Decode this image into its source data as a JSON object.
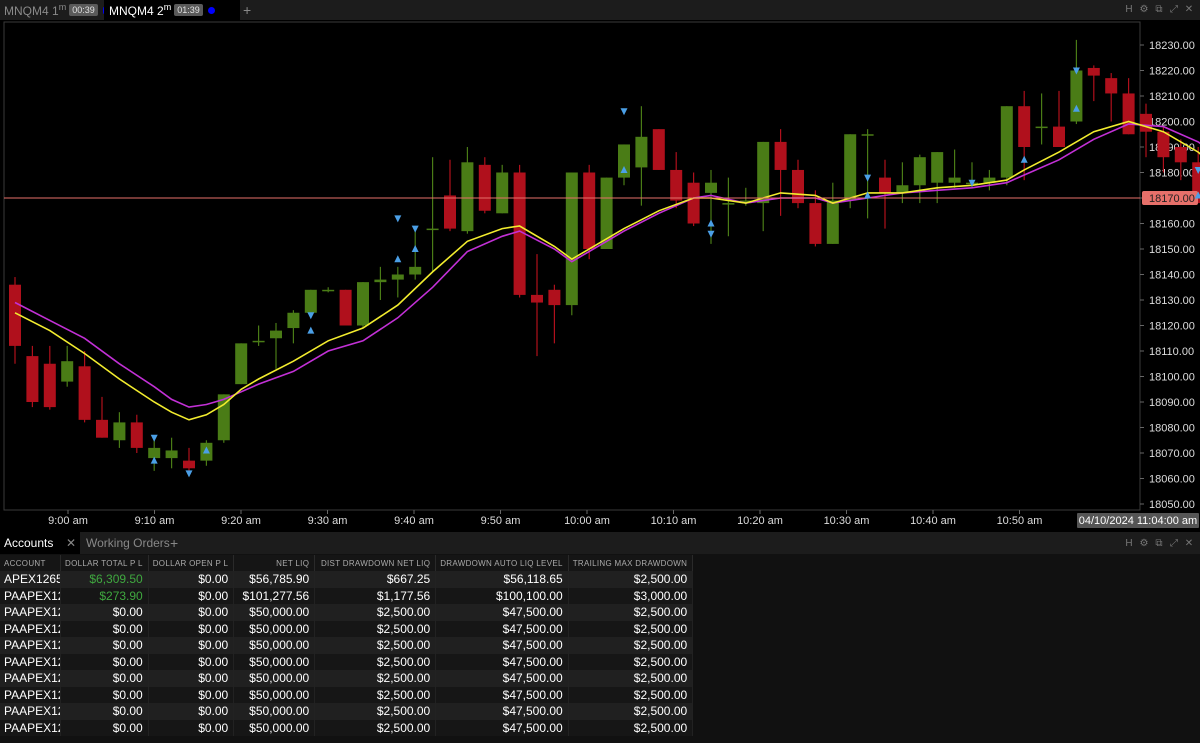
{
  "tabs": [
    {
      "name": "MNQM4 1",
      "sup": "m",
      "timer": "00:39"
    },
    {
      "name": "MNQM4 2",
      "sup": "m",
      "timer": "01:39"
    }
  ],
  "add_tab_label": "+",
  "window_controls": [
    "H",
    "⚙",
    "⧉",
    "⤢",
    "✕"
  ],
  "chart_data": {
    "type": "candlestick",
    "time_labels": [
      "9:00 am",
      "9:10 am",
      "9:20 am",
      "9:30 am",
      "9:40 am",
      "9:50 am",
      "10:00 am",
      "10:10 am",
      "10:20 am",
      "10:30 am",
      "10:40 am",
      "10:50 am"
    ],
    "cursor_time_label": "04/10/2024 11:04:00 am",
    "price_labels": [
      "18230.00",
      "18220.00",
      "18210.00",
      "18200.00",
      "18190.00",
      "18180.00",
      "18170.00",
      "18160.00",
      "18150.00",
      "18140.00",
      "18130.00",
      "18120.00",
      "18110.00",
      "18100.00",
      "18090.00",
      "18080.00",
      "18070.00",
      "18060.00",
      "18050.00"
    ],
    "horizontal_line_price": 18170,
    "horizontal_line_label": "18170.00",
    "ylim": [
      18046,
      18243
    ],
    "colors": {
      "up": "#4a7c16",
      "down": "#b0101c",
      "line": "#e6706a",
      "ema_fast": "#f2ec2e",
      "ema_slow": "#c230d6",
      "marker": "#4b9fe6"
    },
    "bar_minutes": 2,
    "first_bar_time": "8:52 am",
    "candles": [
      [
        18136,
        18139,
        18105,
        18112
      ],
      [
        18108,
        18112,
        18088,
        18090
      ],
      [
        18105,
        18112,
        18087,
        18088
      ],
      [
        18098,
        18112,
        18096,
        18106
      ],
      [
        18104,
        18110,
        18082,
        18083
      ],
      [
        18083,
        18092,
        18076,
        18076
      ],
      [
        18075,
        18086,
        18072,
        18082
      ],
      [
        18082,
        18085,
        18070,
        18072
      ],
      [
        18068,
        18076,
        18063,
        18072
      ],
      [
        18068,
        18076,
        18064,
        18071
      ],
      [
        18067,
        18072,
        18062,
        18064
      ],
      [
        18067,
        18075,
        18065,
        18074
      ],
      [
        18075,
        18093,
        18074,
        18093
      ],
      [
        18097,
        18113,
        18097,
        18113
      ],
      [
        18114,
        18120,
        18112,
        18114
      ],
      [
        18115,
        18121,
        18103,
        18118
      ],
      [
        18119,
        18126,
        18113,
        18125
      ],
      [
        18125,
        18134,
        18124,
        18134
      ],
      [
        18134,
        18135,
        18133,
        18134
      ],
      [
        18134,
        18130,
        18133,
        18120
      ],
      [
        18120,
        18137,
        18119,
        18137
      ],
      [
        18137,
        18143,
        18130,
        18138
      ],
      [
        18138,
        18143,
        18131,
        18140
      ],
      [
        18140,
        18158,
        18138,
        18143
      ],
      [
        18158,
        18186,
        18141,
        18158
      ],
      [
        18171,
        18185,
        18157,
        18158
      ],
      [
        18157,
        18190,
        18156,
        18184
      ],
      [
        18183,
        18186,
        18164,
        18165
      ],
      [
        18164,
        18183,
        18164,
        18180
      ],
      [
        18180,
        18183,
        18131,
        18132
      ],
      [
        18132,
        18148,
        18108,
        18129
      ],
      [
        18134,
        18136,
        18113,
        18128
      ],
      [
        18128,
        18154,
        18124,
        18180
      ],
      [
        18180,
        18183,
        18146,
        18150
      ],
      [
        18150,
        18170,
        18167,
        18178
      ],
      [
        18178,
        18181,
        18175,
        18191
      ],
      [
        18182,
        18206,
        18167,
        18194
      ],
      [
        18197,
        18196,
        18185,
        18181
      ],
      [
        18181,
        18188,
        18166,
        18169
      ],
      [
        18176,
        18180,
        18159,
        18160
      ],
      [
        18172,
        18181,
        18152,
        18176
      ],
      [
        18168,
        18178,
        18155,
        18168
      ],
      [
        18168,
        18174,
        18167,
        18169
      ],
      [
        18168,
        18180,
        18157,
        18192
      ],
      [
        18192,
        18197,
        18163,
        18181
      ],
      [
        18181,
        18185,
        18166,
        18168
      ],
      [
        18168,
        18173,
        18151,
        18152
      ],
      [
        18152,
        18176,
        18152,
        18169
      ],
      [
        18169,
        18191,
        18166,
        18195
      ],
      [
        18195,
        18197,
        18162,
        18195
      ],
      [
        18178,
        18185,
        18158,
        18172
      ],
      [
        18172,
        18184,
        18168,
        18175
      ],
      [
        18175,
        18187,
        18168,
        18186
      ],
      [
        18176,
        18188,
        18168,
        18188
      ],
      [
        18176,
        18189,
        18174,
        18178
      ],
      [
        18176,
        18184,
        18174,
        18176
      ],
      [
        18176,
        18181,
        18173,
        18178
      ],
      [
        18178,
        18205,
        18175,
        18206
      ],
      [
        18206,
        18212,
        18177,
        18190
      ],
      [
        18198,
        18211,
        18191,
        18198
      ],
      [
        18198,
        18212,
        18194,
        18190
      ],
      [
        18200,
        18232,
        18199,
        18220
      ],
      [
        18221,
        18222,
        18208,
        18218
      ],
      [
        18217,
        18219,
        18200,
        18211
      ],
      [
        18211,
        18217,
        18195,
        18195
      ],
      [
        18203,
        18207,
        18186,
        18196
      ],
      [
        18196,
        18198,
        18180,
        18186
      ],
      [
        18190,
        18193,
        18177,
        18184
      ],
      [
        18184,
        18190,
        18169,
        18168
      ],
      [
        18168,
        18171,
        18160,
        18161
      ],
      [
        18161,
        18162,
        18140,
        18145
      ],
      [
        18153,
        18163,
        18138,
        18153
      ],
      [
        18142,
        18166,
        18133,
        18154
      ],
      [
        18150,
        18158,
        18138,
        18155
      ],
      [
        18155,
        18159,
        18149,
        18151
      ],
      [
        18149,
        18160,
        18145,
        18153
      ],
      [
        18151,
        18154,
        18142,
        18149
      ]
    ],
    "markers": [
      {
        "bar": 8,
        "type": "up",
        "price": 18067
      },
      {
        "bar": 8,
        "type": "down",
        "price": 18076
      },
      {
        "bar": 10,
        "type": "down",
        "price": 18062
      },
      {
        "bar": 11,
        "type": "up",
        "price": 18071
      },
      {
        "bar": 17,
        "type": "up",
        "price": 18118
      },
      {
        "bar": 17,
        "type": "down",
        "price": 18124
      },
      {
        "bar": 22,
        "type": "up",
        "price": 18146
      },
      {
        "bar": 22,
        "type": "down",
        "price": 18162
      },
      {
        "bar": 23,
        "type": "up",
        "price": 18150
      },
      {
        "bar": 23,
        "type": "down",
        "price": 18158
      },
      {
        "bar": 35,
        "type": "up",
        "price": 18181
      },
      {
        "bar": 35,
        "type": "down",
        "price": 18204
      },
      {
        "bar": 40,
        "type": "up",
        "price": 18160
      },
      {
        "bar": 40,
        "type": "down",
        "price": 18156
      },
      {
        "bar": 49,
        "type": "up",
        "price": 18171
      },
      {
        "bar": 49,
        "type": "down",
        "price": 18178
      },
      {
        "bar": 55,
        "type": "down",
        "price": 18176
      },
      {
        "bar": 58,
        "type": "up",
        "price": 18185
      },
      {
        "bar": 61,
        "type": "up",
        "price": 18205
      },
      {
        "bar": 61,
        "type": "down",
        "price": 18220
      },
      {
        "bar": 68,
        "type": "up",
        "price": 18171
      },
      {
        "bar": 68,
        "type": "down",
        "price": 18181
      }
    ],
    "ema_fast": [
      [
        0,
        18125
      ],
      [
        2,
        18118
      ],
      [
        4,
        18109
      ],
      [
        6,
        18099
      ],
      [
        8,
        18090
      ],
      [
        9,
        18086
      ],
      [
        10,
        18083
      ],
      [
        11,
        18085
      ],
      [
        12,
        18089
      ],
      [
        13,
        18095
      ],
      [
        14,
        18099
      ],
      [
        16,
        18106
      ],
      [
        18,
        18114
      ],
      [
        20,
        18119
      ],
      [
        22,
        18128
      ],
      [
        24,
        18141
      ],
      [
        26,
        18153
      ],
      [
        28,
        18158
      ],
      [
        29,
        18159
      ],
      [
        31,
        18151
      ],
      [
        32,
        18146
      ],
      [
        34,
        18154
      ],
      [
        35,
        18158
      ],
      [
        37,
        18165
      ],
      [
        39,
        18170
      ],
      [
        40,
        18170
      ],
      [
        42,
        18168
      ],
      [
        44,
        18172
      ],
      [
        46,
        18171
      ],
      [
        47,
        18168
      ],
      [
        49,
        18172
      ],
      [
        51,
        18172
      ],
      [
        53,
        18174
      ],
      [
        55,
        18175
      ],
      [
        57,
        18177
      ],
      [
        58,
        18181
      ],
      [
        60,
        18188
      ],
      [
        62,
        18196
      ],
      [
        64,
        18200
      ],
      [
        66,
        18196
      ],
      [
        68,
        18188
      ],
      [
        70,
        18176
      ],
      [
        72,
        18165
      ],
      [
        74,
        18161
      ],
      [
        75,
        18158
      ],
      [
        76,
        18157
      ]
    ],
    "ema_slow": [
      [
        0,
        18129
      ],
      [
        2,
        18122
      ],
      [
        4,
        18115
      ],
      [
        6,
        18105
      ],
      [
        8,
        18096
      ],
      [
        9,
        18091
      ],
      [
        10,
        18088
      ],
      [
        11,
        18089
      ],
      [
        12,
        18091
      ],
      [
        13,
        18094
      ],
      [
        14,
        18097
      ],
      [
        16,
        18102
      ],
      [
        18,
        18110
      ],
      [
        20,
        18114
      ],
      [
        22,
        18123
      ],
      [
        24,
        18135
      ],
      [
        26,
        18149
      ],
      [
        28,
        18155
      ],
      [
        29,
        18157
      ],
      [
        31,
        18150
      ],
      [
        32,
        18145
      ],
      [
        34,
        18153
      ],
      [
        35,
        18157
      ],
      [
        37,
        18164
      ],
      [
        39,
        18170
      ],
      [
        40,
        18171
      ],
      [
        42,
        18168
      ],
      [
        44,
        18170
      ],
      [
        46,
        18170
      ],
      [
        47,
        18168
      ],
      [
        49,
        18170
      ],
      [
        51,
        18172
      ],
      [
        53,
        18173
      ],
      [
        55,
        18174
      ],
      [
        57,
        18176
      ],
      [
        58,
        18179
      ],
      [
        60,
        18185
      ],
      [
        62,
        18193
      ],
      [
        64,
        18199
      ],
      [
        66,
        18198
      ],
      [
        68,
        18192
      ],
      [
        70,
        18182
      ],
      [
        72,
        18170
      ],
      [
        74,
        18165
      ],
      [
        75,
        18162
      ],
      [
        76,
        18160
      ]
    ]
  },
  "bottom_panel": {
    "tabs": [
      "Accounts",
      "Working Orders"
    ],
    "close_label": "✕",
    "add_label": "+",
    "columns": [
      "ACCOUNT",
      "DOLLAR TOTAL P L",
      "DOLLAR OPEN P L",
      "NET LIQ",
      "DIST DRAWDOWN NET LIQ",
      "DRAWDOWN AUTO LIQ LEVEL",
      "TRAILING MAX DRAWDOWN"
    ],
    "rows": [
      [
        "APEX1265",
        "$6,309.50",
        "$0.00",
        "$56,785.90",
        "$667.25",
        "$56,118.65",
        "$2,500.00"
      ],
      [
        "PAAPEX12",
        "$273.90",
        "$0.00",
        "$101,277.56",
        "$1,177.56",
        "$100,100.00",
        "$3,000.00"
      ],
      [
        "PAAPEX12",
        "$0.00",
        "$0.00",
        "$50,000.00",
        "$2,500.00",
        "$47,500.00",
        "$2,500.00"
      ],
      [
        "PAAPEX12",
        "$0.00",
        "$0.00",
        "$50,000.00",
        "$2,500.00",
        "$47,500.00",
        "$2,500.00"
      ],
      [
        "PAAPEX12",
        "$0.00",
        "$0.00",
        "$50,000.00",
        "$2,500.00",
        "$47,500.00",
        "$2,500.00"
      ],
      [
        "PAAPEX12",
        "$0.00",
        "$0.00",
        "$50,000.00",
        "$2,500.00",
        "$47,500.00",
        "$2,500.00"
      ],
      [
        "PAAPEX12",
        "$0.00",
        "$0.00",
        "$50,000.00",
        "$2,500.00",
        "$47,500.00",
        "$2,500.00"
      ],
      [
        "PAAPEX12",
        "$0.00",
        "$0.00",
        "$50,000.00",
        "$2,500.00",
        "$47,500.00",
        "$2,500.00"
      ],
      [
        "PAAPEX12",
        "$0.00",
        "$0.00",
        "$50,000.00",
        "$2,500.00",
        "$47,500.00",
        "$2,500.00"
      ],
      [
        "PAAPEX12",
        "$0.00",
        "$0.00",
        "$50,000.00",
        "$2,500.00",
        "$47,500.00",
        "$2,500.00"
      ]
    ],
    "positive_color": "#3fa83f"
  }
}
